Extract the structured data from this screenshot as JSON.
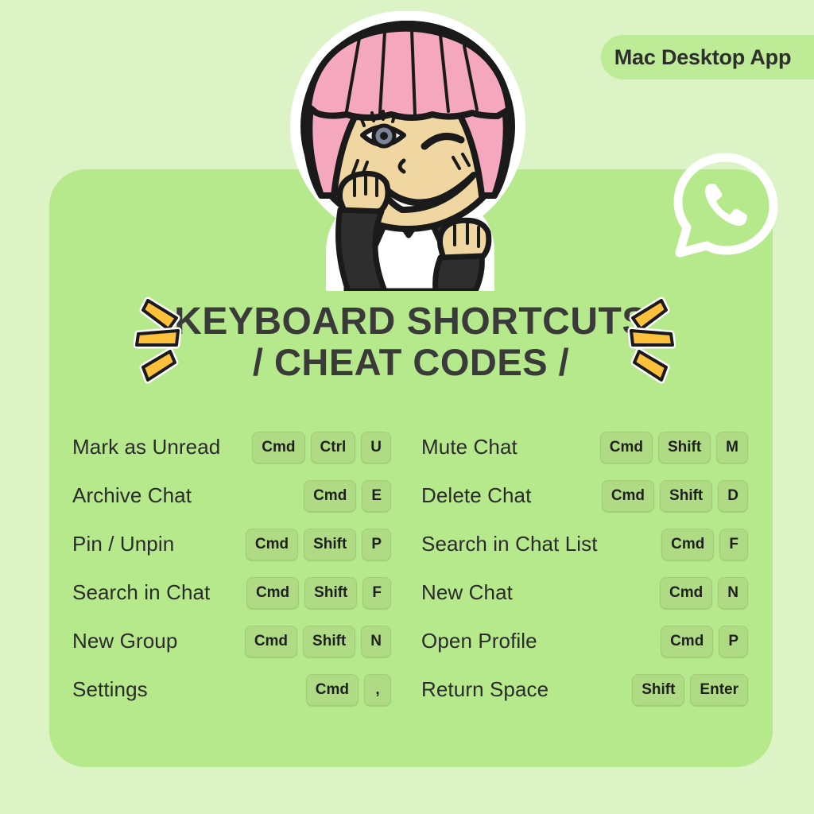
{
  "badge": {
    "label": "Mac Desktop App"
  },
  "logo": {
    "name": "whatsapp-logo"
  },
  "character": {
    "name": "cartoon-girl-winking-illustration"
  },
  "title": {
    "line1": "KEYBOARD SHORTCUTS",
    "line2": "/ CHEAT CODES /"
  },
  "colors": {
    "page_background": "#dcf3c6",
    "card_background": "#b6e88c",
    "badge_background": "#bdeb96",
    "key_background": "#aedb84",
    "key_border": "#9fce74",
    "text": "#2b2b2b",
    "title_text": "#3a3a3a",
    "sparkle_fill": "#fcc03a",
    "sparkle_outline": "#1a1a1a"
  },
  "shortcuts": {
    "left": [
      {
        "label": "Mark as Unread",
        "keys": [
          "Cmd",
          "Ctrl",
          "U"
        ]
      },
      {
        "label": "Archive Chat",
        "keys": [
          "Cmd",
          "E"
        ]
      },
      {
        "label": "Pin / Unpin",
        "keys": [
          "Cmd",
          "Shift",
          "P"
        ]
      },
      {
        "label": "Search in Chat",
        "keys": [
          "Cmd",
          "Shift",
          "F"
        ]
      },
      {
        "label": "New Group",
        "keys": [
          "Cmd",
          "Shift",
          "N"
        ]
      },
      {
        "label": "Settings",
        "keys": [
          "Cmd",
          ","
        ]
      }
    ],
    "right": [
      {
        "label": "Mute Chat",
        "keys": [
          "Cmd",
          "Shift",
          "M"
        ]
      },
      {
        "label": "Delete Chat",
        "keys": [
          "Cmd",
          "Shift",
          "D"
        ]
      },
      {
        "label": "Search in Chat List",
        "keys": [
          "Cmd",
          "F"
        ]
      },
      {
        "label": "New Chat",
        "keys": [
          "Cmd",
          "N"
        ]
      },
      {
        "label": "Open Profile",
        "keys": [
          "Cmd",
          "P"
        ]
      },
      {
        "label": "Return Space",
        "keys": [
          "Shift",
          "Enter"
        ]
      }
    ]
  }
}
